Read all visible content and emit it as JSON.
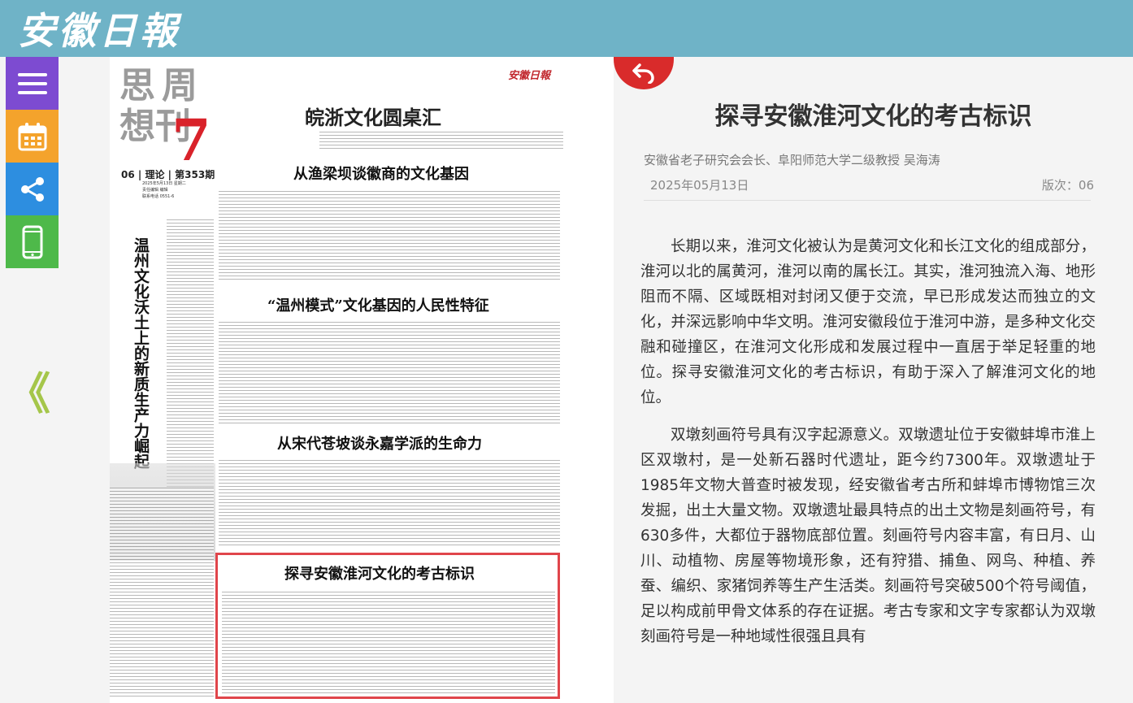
{
  "header": {
    "logo_text": "安徽日報"
  },
  "toolbar": {
    "menu_icon": "menu-icon",
    "calendar_icon": "calendar-icon",
    "share_icon": "share-icon",
    "mobile_icon": "mobile-phone-icon",
    "prev_page_glyph": "《"
  },
  "paper": {
    "masthead_chars": [
      "思",
      "周",
      "想",
      "刊"
    ],
    "masthead_issue": "7",
    "paper_logo": "安徽日報",
    "section_title": "皖浙文化圆桌汇",
    "page_info": "06 | 理论 | 第353期",
    "page_meta": "2025年5月13日 星期二\n责任编辑 编辑\n联系电话 0551-6",
    "vertical_title": "温州文化沃土上的新质生产力崛起",
    "headlines": [
      "从渔梁坝谈徽商的文化基因",
      "“温州模式”文化基因的人民性特征",
      "从宋代苍坡谈永嘉学派的生命力",
      "探寻安徽淮河文化的考古标识"
    ]
  },
  "article": {
    "title": "探寻安徽淮河文化的考古标识",
    "author": "安徽省老子研究会会长、阜阳师范大学二级教授 吴海涛",
    "date": "2025年05月13日",
    "edition": "版次：06",
    "paragraphs": [
      "长期以来，淮河文化被认为是黄河文化和长江文化的组成部分，淮河以北的属黄河，淮河以南的属长江。其实，淮河独流入海、地形阻而不隔、区域既相对封闭又便于交流，早已形成发达而独立的文化，并深远影响中华文明。淮河安徽段位于淮河中游，是多种文化交融和碰撞区，在淮河文化形成和发展过程中一直居于举足轻重的地位。探寻安徽淮河文化的考古标识，有助于深入了解淮河文化的地位。",
      "双墩刻画符号具有汉字起源意义。双墩遗址位于安徽蚌埠市淮上区双墩村，是一处新石器时代遗址，距今约7300年。双墩遗址于1985年文物大普查时被发现，经安徽省考古所和蚌埠市博物馆三次发掘，出土大量文物。双墩遗址最具特点的出土文物是刻画符号，有630多件，大都位于器物底部位置。刻画符号内容丰富，有日月、山川、动植物、房屋等物境形象，还有狩猎、捕鱼、网鸟、种植、养蚕、编织、家猪饲养等生产生活类。刻画符号突破500个符号阈值，足以构成前甲骨文体系的存在证据。考古专家和文字专家都认为双墩刻画符号是一种地域性很强且具有"
    ]
  },
  "colors": {
    "topbar": "#6fb3c7",
    "menu": "#7d4bd1",
    "calendar": "#f4a32c",
    "share": "#2d8ee0",
    "mobile": "#4eb94a",
    "accent_red": "#d92b2b",
    "highlight": "#e0454b"
  }
}
